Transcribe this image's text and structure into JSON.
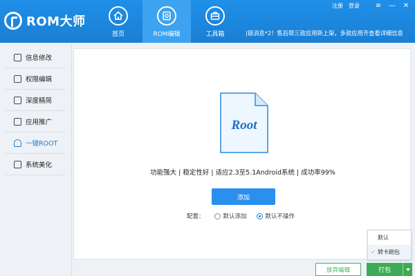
{
  "app": {
    "logo_text": "ROM大师",
    "top_links": [
      "注册",
      "登录"
    ],
    "window_buttons": [
      "≡",
      "—",
      "✕"
    ]
  },
  "nav": [
    {
      "label": "首页",
      "icon": "home-icon",
      "active": false
    },
    {
      "label": "ROM编辑",
      "icon": "rom-edit-icon",
      "active": true
    },
    {
      "label": "工具箱",
      "icon": "toolbox-icon",
      "active": false
    }
  ],
  "ticker": "|锁消息*2！售后帮三款应用新上架，多款应用齐查看详细信息",
  "sidebar": {
    "items": [
      {
        "label": "信息修改",
        "icon": "edit-icon",
        "active": false
      },
      {
        "label": "权限编辑",
        "icon": "permission-icon",
        "active": false
      },
      {
        "label": "深度精简",
        "icon": "trash-icon",
        "active": false
      },
      {
        "label": "应用推广",
        "icon": "apps-icon",
        "active": false
      },
      {
        "label": "一键ROOT",
        "icon": "android-icon",
        "active": true
      },
      {
        "label": "系统美化",
        "icon": "image-icon",
        "active": false
      }
    ]
  },
  "main": {
    "doc_label": "Root",
    "features": "功能强大 | 稳定性好 | 适应2.3至5.1Android系统 | 成功率99%",
    "add_button": "添加",
    "config_label": "配置：",
    "options": [
      {
        "label": "默认添加",
        "checked": false
      },
      {
        "label": "默认不操作",
        "checked": true
      }
    ]
  },
  "bottom": {
    "discard_button": "放弃编辑",
    "pack_button": "打包",
    "dropdown": [
      {
        "label": "默认",
        "selected": false
      },
      {
        "label": "转卡刷包",
        "selected": true
      }
    ]
  },
  "colors": {
    "header": "#1a7fd4",
    "accent": "#2b8ff0",
    "green": "#3cab55"
  }
}
